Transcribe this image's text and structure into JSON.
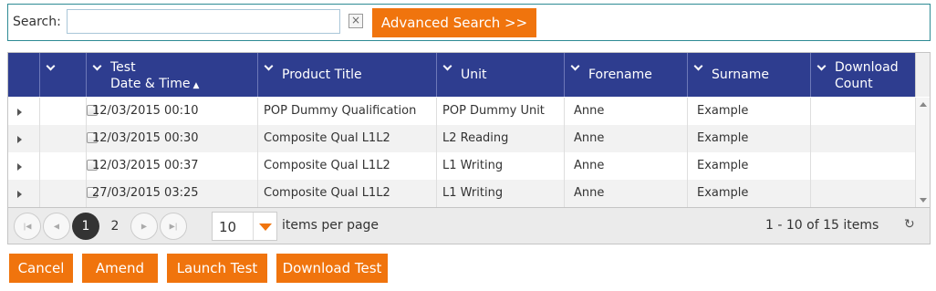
{
  "search": {
    "label": "Search:",
    "value": "",
    "placeholder": "",
    "clear_glyph": "×",
    "advanced_label": "Advanced Search >>"
  },
  "columns": [
    {
      "label": ""
    },
    {
      "label": "Test\nDate & Time",
      "sort": "ascending"
    },
    {
      "label": "Product Title"
    },
    {
      "label": "Unit"
    },
    {
      "label": "Forename"
    },
    {
      "label": "Surname"
    },
    {
      "label": "Download Count"
    }
  ],
  "header": {
    "test_line1": "Test",
    "test_line2": "Date & Time",
    "sort_glyph": "▲",
    "product": "Product Title",
    "unit": "Unit",
    "forename": "Forename",
    "surname": "Surname",
    "download_line1": "Download",
    "download_line2": "Count"
  },
  "rows": [
    {
      "date": "12/03/2015 00:10",
      "product": "POP Dummy Qualification",
      "unit": "POP Dummy Unit",
      "forename": "Anne",
      "surname": "Example",
      "download_count": ""
    },
    {
      "date": "12/03/2015 00:30",
      "product": "Composite Qual L1L2",
      "unit": "L2 Reading",
      "forename": "Anne",
      "surname": "Example",
      "download_count": ""
    },
    {
      "date": "12/03/2015 00:37",
      "product": "Composite Qual L1L2",
      "unit": "L1 Writing",
      "forename": "Anne",
      "surname": "Example",
      "download_count": ""
    },
    {
      "date": "27/03/2015 03:25",
      "product": "Composite Qual L1L2",
      "unit": "L1 Writing",
      "forename": "Anne",
      "surname": "Example",
      "download_count": ""
    }
  ],
  "pager": {
    "pages": [
      "1",
      "2"
    ],
    "current_page": "1",
    "page_size": "10",
    "items_per_page_label": "items per page",
    "count_text": "1 - 10 of 15 items",
    "refresh_glyph": "↻"
  },
  "actions": {
    "cancel": "Cancel",
    "amend": "Amend",
    "launch": "Launch Test",
    "download": "Download Test"
  },
  "colors": {
    "accent": "#f0740d",
    "header_bg": "#2e3d8f",
    "search_border": "#2e8b94"
  },
  "icons": {
    "clear": "close-icon",
    "expand": "expand-arrow-icon",
    "first": "first-page-icon",
    "prev": "previous-page-icon",
    "next": "next-page-icon",
    "last": "last-page-icon",
    "dropdown": "dropdown-arrow-icon",
    "refresh": "refresh-icon"
  }
}
